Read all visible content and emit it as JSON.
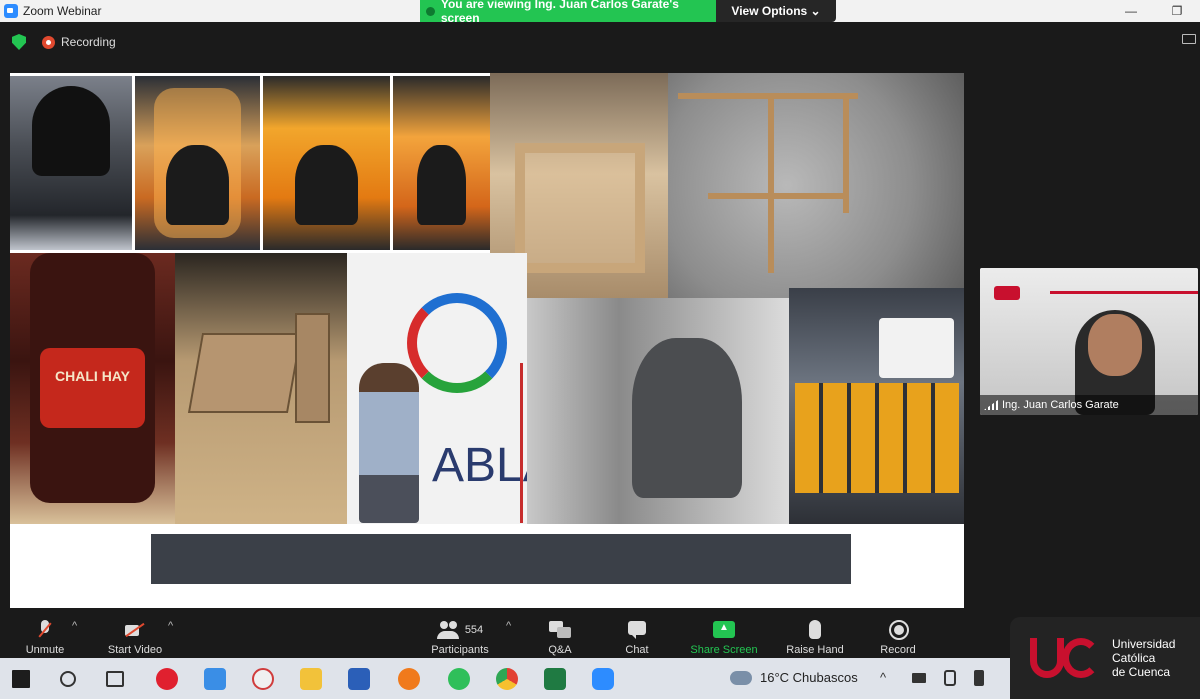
{
  "window": {
    "title": "Zoom Webinar",
    "minimize_icon": "minimize-icon",
    "maximize_icon": "maximize-icon"
  },
  "share_banner": {
    "text": "You are viewing Ing. Juan Carlos Garate's screen",
    "view_options_label": "View Options ⌄"
  },
  "status": {
    "recording_label": "Recording"
  },
  "slide": {
    "bottle_label": "CHALI HAY",
    "fablab_text": "ABLA"
  },
  "video": {
    "participant_name": "Ing. Juan Carlos Garate"
  },
  "toolbar": {
    "unmute_label": "Unmute",
    "start_video_label": "Start Video",
    "participants_label": "Participants",
    "participants_count": "554",
    "qa_label": "Q&A",
    "chat_label": "Chat",
    "share_screen_label": "Share Screen",
    "raise_hand_label": "Raise Hand",
    "record_label": "Record",
    "caret": "^"
  },
  "taskbar": {
    "weather_text": "16°C  Chubascos",
    "tray_caret": "^"
  },
  "branding": {
    "university_line1": "Universidad",
    "university_line2": "Católica",
    "university_line3": "de Cuenca"
  },
  "colors": {
    "zoom_green": "#23c552",
    "zoom_blue": "#2d8cff",
    "brand_red": "#c8102e"
  }
}
